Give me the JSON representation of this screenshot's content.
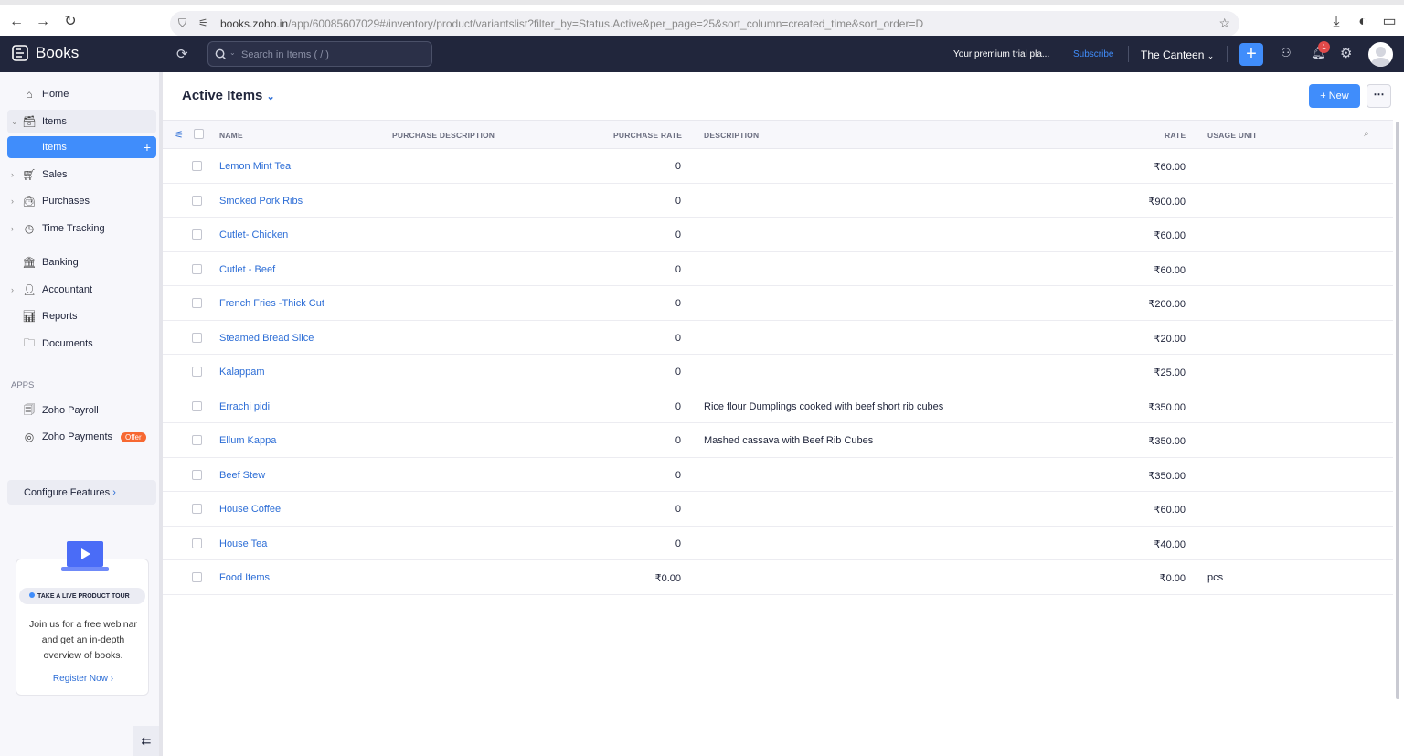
{
  "browser": {
    "url_host": "books.zoho.in",
    "url_path": "/app/60085607029#/inventory/product/variantslist?filter_by=Status.Active&per_page=25&sort_column=created_time&sort_order=D"
  },
  "topbar": {
    "brand": "Books",
    "search_placeholder": "Search in Items ( / )",
    "trial_text": "Your premium trial pla...",
    "subscribe_label": "Subscribe",
    "org_name": "The Canteen",
    "notification_count": "1"
  },
  "sidebar": {
    "items": [
      {
        "label": "Home",
        "icon": "home-icon"
      },
      {
        "label": "Items",
        "icon": "items-icon"
      },
      {
        "label": "Items"
      },
      {
        "label": "Sales",
        "icon": "cart-icon"
      },
      {
        "label": "Purchases",
        "icon": "bag-icon"
      },
      {
        "label": "Time Tracking",
        "icon": "clock-icon"
      },
      {
        "label": "Banking",
        "icon": "bank-icon"
      },
      {
        "label": "Accountant",
        "icon": "accountant-icon"
      },
      {
        "label": "Reports",
        "icon": "chart-icon"
      },
      {
        "label": "Documents",
        "icon": "folder-icon"
      }
    ],
    "apps_heading": "APPS",
    "apps": [
      {
        "label": "Zoho Payroll"
      },
      {
        "label": "Zoho Payments",
        "badge": "Offer"
      }
    ],
    "configure_label": "Configure Features",
    "tour": {
      "badge": "TAKE A LIVE PRODUCT TOUR",
      "text": "Join us for a free webinar and get an in-depth overview of books.",
      "link": "Register Now"
    }
  },
  "main": {
    "title": "Active Items",
    "new_label": "New",
    "columns": [
      "NAME",
      "PURCHASE DESCRIPTION",
      "PURCHASE RATE",
      "DESCRIPTION",
      "RATE",
      "USAGE UNIT"
    ],
    "rows": [
      {
        "name": "Lemon Mint Tea",
        "purchase_description": "",
        "purchase_rate": "0",
        "description": "",
        "rate": "₹60.00",
        "unit": ""
      },
      {
        "name": "Smoked Pork Ribs",
        "purchase_description": "",
        "purchase_rate": "0",
        "description": "",
        "rate": "₹900.00",
        "unit": ""
      },
      {
        "name": "Cutlet- Chicken",
        "purchase_description": "",
        "purchase_rate": "0",
        "description": "",
        "rate": "₹60.00",
        "unit": ""
      },
      {
        "name": "Cutlet - Beef",
        "purchase_description": "",
        "purchase_rate": "0",
        "description": "",
        "rate": "₹60.00",
        "unit": ""
      },
      {
        "name": "French Fries -Thick Cut",
        "purchase_description": "",
        "purchase_rate": "0",
        "description": "",
        "rate": "₹200.00",
        "unit": ""
      },
      {
        "name": "Steamed Bread Slice",
        "purchase_description": "",
        "purchase_rate": "0",
        "description": "",
        "rate": "₹20.00",
        "unit": ""
      },
      {
        "name": "Kalappam",
        "purchase_description": "",
        "purchase_rate": "0",
        "description": "",
        "rate": "₹25.00",
        "unit": ""
      },
      {
        "name": "Errachi pidi",
        "purchase_description": "",
        "purchase_rate": "0",
        "description": "Rice flour Dumplings cooked with beef short rib cubes",
        "rate": "₹350.00",
        "unit": ""
      },
      {
        "name": "Ellum Kappa",
        "purchase_description": "",
        "purchase_rate": "0",
        "description": "Mashed cassava with Beef Rib Cubes",
        "rate": "₹350.00",
        "unit": ""
      },
      {
        "name": "Beef Stew",
        "purchase_description": "",
        "purchase_rate": "0",
        "description": "",
        "rate": "₹350.00",
        "unit": ""
      },
      {
        "name": "House Coffee",
        "purchase_description": "",
        "purchase_rate": "0",
        "description": "",
        "rate": "₹60.00",
        "unit": ""
      },
      {
        "name": "House Tea",
        "purchase_description": "",
        "purchase_rate": "0",
        "description": "",
        "rate": "₹40.00",
        "unit": ""
      },
      {
        "name": "Food Items",
        "purchase_description": "",
        "purchase_rate": "₹0.00",
        "description": "",
        "rate": "₹0.00",
        "unit": "pcs"
      }
    ]
  },
  "colors": {
    "topbar_bg": "#21263c",
    "accent": "#408dfb",
    "link": "#2c6dd6",
    "badge": "#f76831"
  }
}
